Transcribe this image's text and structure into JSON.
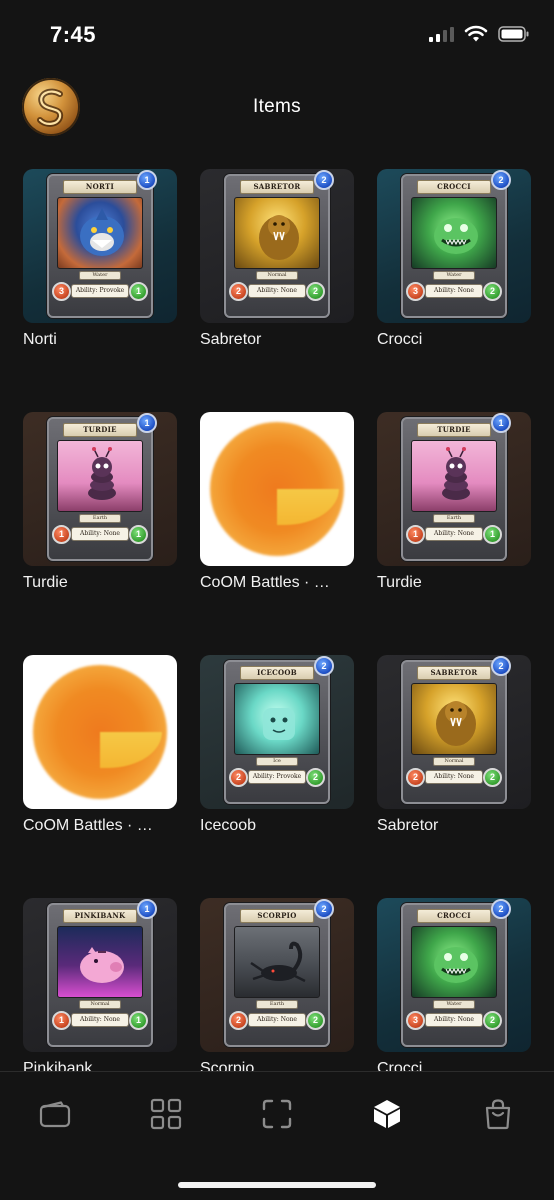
{
  "status_bar": {
    "time": "7:45",
    "icons": [
      "signal-icon",
      "wifi-icon",
      "battery-icon"
    ]
  },
  "header": {
    "title": "Items",
    "logo_icon": "app-logo-icon"
  },
  "items": [
    {
      "label": "Norti",
      "kind": "card",
      "card": {
        "name": "NORTI",
        "cost": "1",
        "type": "Water",
        "ability": "Ability: Provoke",
        "attack": "3",
        "health": "1"
      }
    },
    {
      "label": "Sabretor",
      "kind": "card",
      "card": {
        "name": "SABRETOR",
        "cost": "2",
        "type": "Normal",
        "ability": "Ability: None",
        "attack": "2",
        "health": "2"
      }
    },
    {
      "label": "Crocci",
      "kind": "card",
      "card": {
        "name": "CROCCI",
        "cost": "2",
        "type": "Water",
        "ability": "Ability: None",
        "attack": "3",
        "health": "2"
      }
    },
    {
      "label": "Turdie",
      "kind": "card",
      "card": {
        "name": "TURDIE",
        "cost": "1",
        "type": "Earth",
        "ability": "Ability: None",
        "attack": "1",
        "health": "1"
      }
    },
    {
      "label": "CoOM Battles · …",
      "kind": "coin"
    },
    {
      "label": "Turdie",
      "kind": "card",
      "card": {
        "name": "TURDIE",
        "cost": "1",
        "type": "Earth",
        "ability": "Ability: None",
        "attack": "1",
        "health": "1"
      }
    },
    {
      "label": "CoOM Battles · …",
      "kind": "coin"
    },
    {
      "label": "Icecoob",
      "kind": "card",
      "card": {
        "name": "ICECOOB",
        "cost": "2",
        "type": "Ice",
        "ability": "Ability: Provoke",
        "attack": "2",
        "health": "2"
      }
    },
    {
      "label": "Sabretor",
      "kind": "card",
      "card": {
        "name": "SABRETOR",
        "cost": "2",
        "type": "Normal",
        "ability": "Ability: None",
        "attack": "2",
        "health": "2"
      }
    },
    {
      "label": "Pinkibank",
      "kind": "card",
      "card": {
        "name": "PINKIBANK",
        "cost": "1",
        "type": "Normal",
        "ability": "Ability: None",
        "attack": "1",
        "health": "1"
      }
    },
    {
      "label": "Scorpio",
      "kind": "card",
      "card": {
        "name": "SCORPIO",
        "cost": "2",
        "type": "Earth",
        "ability": "Ability: None",
        "attack": "2",
        "health": "2"
      }
    },
    {
      "label": "Crocci",
      "kind": "card",
      "card": {
        "name": "CROCCI",
        "cost": "2",
        "type": "Water",
        "ability": "Ability: None",
        "attack": "3",
        "health": "2"
      }
    }
  ],
  "tab_bar": {
    "tabs": [
      {
        "icon": "wallet-icon",
        "active": false
      },
      {
        "icon": "grid-icon",
        "active": false
      },
      {
        "icon": "scan-icon",
        "active": false
      },
      {
        "icon": "cube-icon",
        "active": true
      },
      {
        "icon": "shopping-bag-icon",
        "active": false
      }
    ]
  },
  "colors": {
    "background": "#141414",
    "text": "#ffffff",
    "inactive_tab": "#8c8c8c",
    "active_tab": "#ffffff"
  }
}
